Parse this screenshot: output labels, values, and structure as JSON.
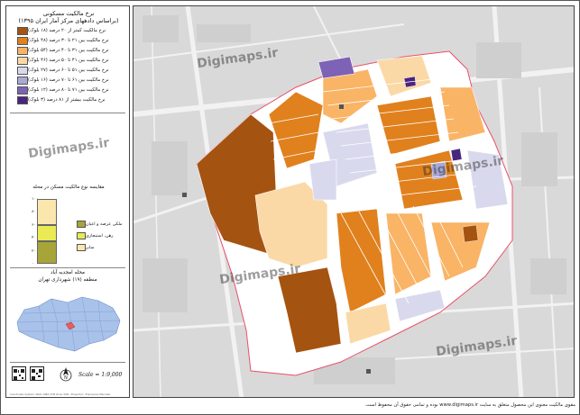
{
  "legend": {
    "title_line1": "نرخ مالکیت مسکونی",
    "title_line2": "(براساس دادههای مرکز آمار ایران ۱۳۹۵)",
    "items": [
      {
        "label": "نرخ مالکیت کمتر از ۲۰ درصد (۱۸ بلوک)",
        "color": "#a55311"
      },
      {
        "label": "نرخ مالکیت بین ۲۱ تا ۳۰ درصد (۴۸ بلوک)",
        "color": "#e0811e"
      },
      {
        "label": "نرخ مالکیت بین ۳۱ تا ۴۰ درصد (۵۴ بلوک)",
        "color": "#f9b466"
      },
      {
        "label": "نرخ مالکیت بین ۴۱ تا ۵۰ درصد (۴۶ بلوک)",
        "color": "#fbd9a6"
      },
      {
        "label": "نرخ مالکیت بین ۵۱ تا ۶۰ درصد (۲۷ بلوک)",
        "color": "#d9d9ee"
      },
      {
        "label": "نرخ مالکیت بین ۶۱ تا ۷۰ درصد (۱۶ بلوک)",
        "color": "#a9a9d8"
      },
      {
        "label": "نرخ مالکیت بین ۷۱ تا ۸۰ درصد (۱۲ بلوک)",
        "color": "#7d62b5"
      },
      {
        "label": "نرخ مالکیت بیشتر از ۸۱ درصد (۳ بلوک)",
        "color": "#4a2580"
      }
    ]
  },
  "bar": {
    "title": "مقایسه نوع مالکیت مسکن در محله",
    "ticks": [
      "۱۰۰",
      "۸۰",
      "۶۰",
      "۴۰",
      "۲۰",
      "۰"
    ],
    "items": [
      {
        "label": "ملکی عرصه و اعیان",
        "color": "#a7a43a",
        "value": 35
      },
      {
        "label": "رهن، استیجاری",
        "color": "#eaea55",
        "value": 25
      },
      {
        "label": "سایر",
        "color": "#fbe7ad",
        "value": 40
      }
    ]
  },
  "location": {
    "title_line1": "محله امجدیه آباد",
    "title_line2": "منطقه (۱۹) شهرداری تهران"
  },
  "scale_text": "Scale = 1:9,000",
  "north_label": "N",
  "tiny_credits": "Coordinate System: WGS 1984 UTM Zone 39N - Projection: Transverse Mercator",
  "watermark_text": "Digimaps.ir",
  "footer": "مقوی مالکیت معنوی این محصول متعلق به سایت www.digimaps.ir بوده و تمامی حقوق آن محفوظ است.",
  "colors": {
    "background_map": "#d9d9d9",
    "road": "#f4f4f4",
    "boundary": "#e8506a",
    "neighborhood_fill": "#ffffff"
  }
}
